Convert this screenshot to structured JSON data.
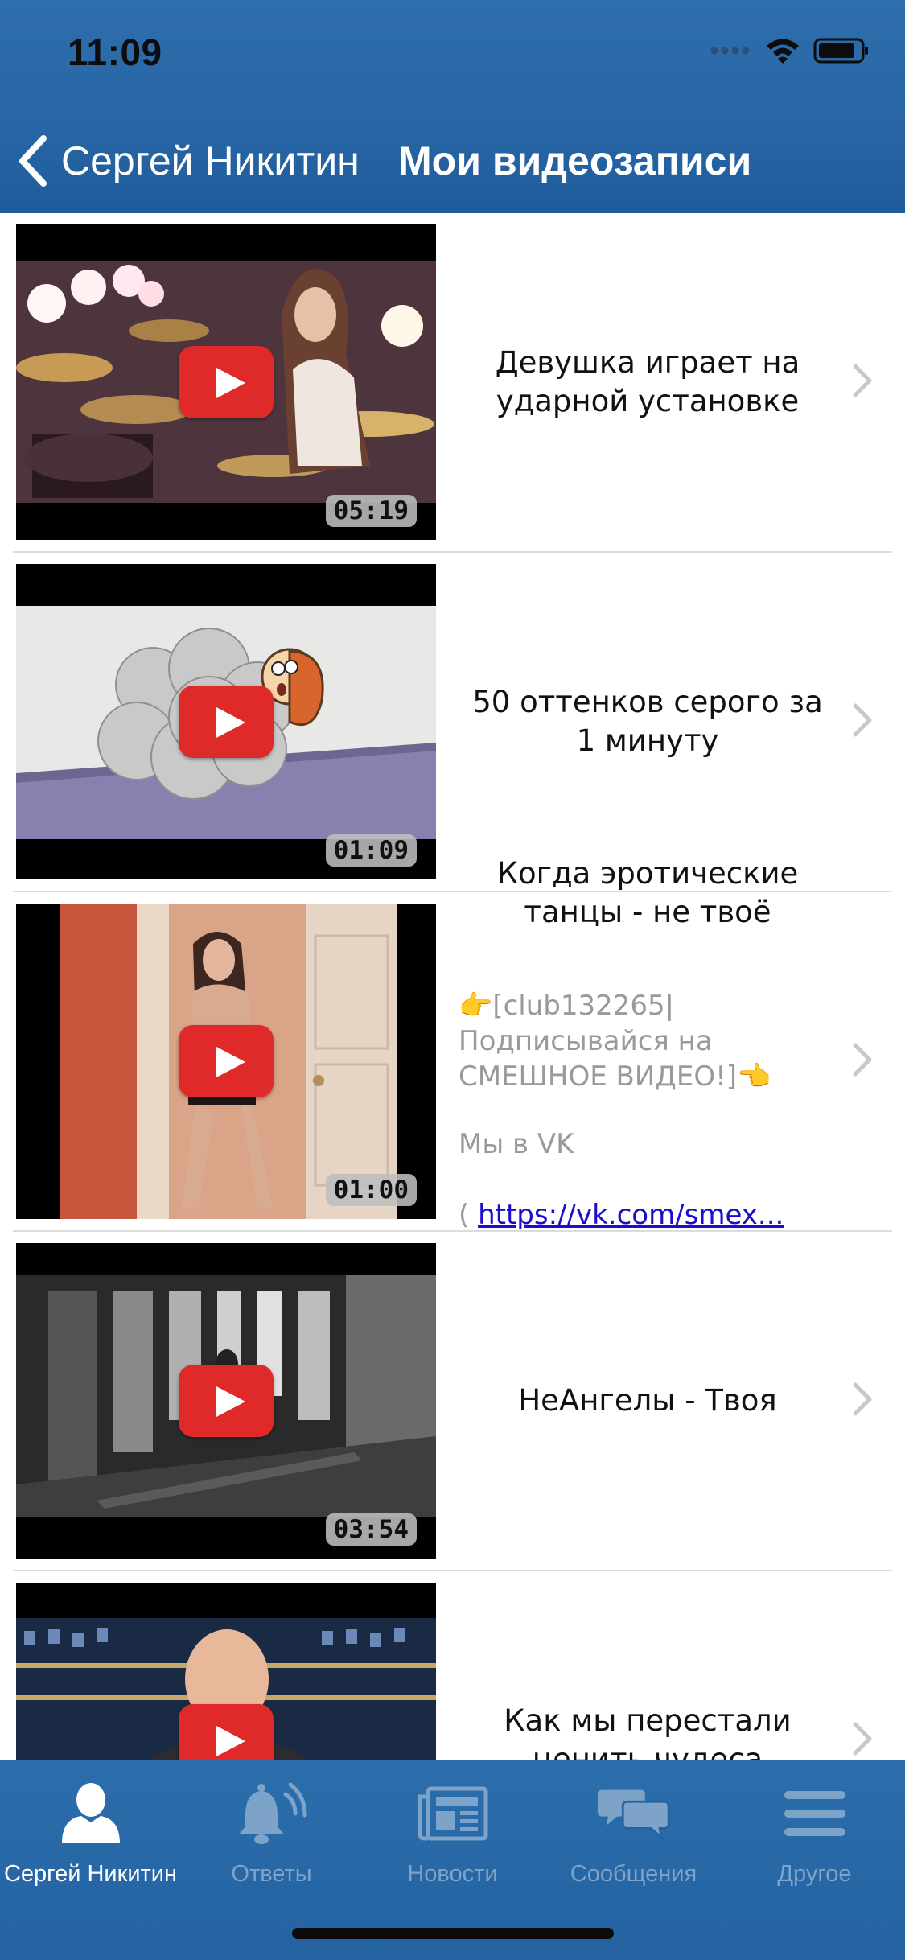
{
  "status_bar": {
    "time": "11:09"
  },
  "nav": {
    "back_label": "Сергей Никитин",
    "title": "Мои видеозаписи"
  },
  "videos": [
    {
      "title": "Девушка играет на\nударной установке",
      "duration": "05:19",
      "thumbnail": "drummer-thumbnail"
    },
    {
      "title": "50 оттенков серого за\n1 минуту",
      "duration": "01:09",
      "thumbnail": "cartoon-cloud-thumbnail"
    },
    {
      "title": "Когда эротические\nтанцы - не твоё",
      "duration": "01:00",
      "thumbnail": "dancing-woman-thumbnail",
      "description": "👉[club132265|\nПодписывайся на\nСМЕШНОЕ ВИДЕО!]👈",
      "description_more_prefix": "Мы в VK",
      "description_link_prefix": "( ",
      "description_link": "https://vk.com/smex..."
    },
    {
      "title": "НеАнгелы - Твоя",
      "duration": "03:54",
      "thumbnail": "grey-corridor-thumbnail"
    },
    {
      "title": "Как мы перестали\nценить чудеса",
      "duration": "",
      "thumbnail": "talk-show-thumbnail"
    }
  ],
  "tabbar": {
    "items": [
      {
        "label": "Сергей Никитин",
        "icon": "person-icon",
        "active": true
      },
      {
        "label": "Ответы",
        "icon": "bell-icon",
        "active": false
      },
      {
        "label": "Новости",
        "icon": "newspaper-icon",
        "active": false
      },
      {
        "label": "Сообщения",
        "icon": "chat-bubbles-icon",
        "active": false
      },
      {
        "label": "Другое",
        "icon": "menu-icon",
        "active": false
      }
    ]
  },
  "colors": {
    "header": "#2866a6",
    "tabbar": "#2462a1",
    "play_button": "#e02a2a",
    "link": "#1a0dcc"
  }
}
